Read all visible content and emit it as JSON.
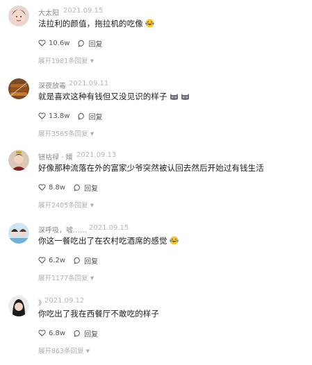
{
  "comments": [
    {
      "username": "大太阳",
      "date": "2021.09.15",
      "text": "法拉利的颜值，拖拉机的吃像",
      "emoji": "laughing-tears",
      "likes": "10.6w",
      "reply_label": "回复",
      "expand_label": "展开1981条回复"
    },
    {
      "username": "深夜放毒",
      "date": "2021.09.11",
      "text": "就是喜欢这种有钱但又没见识的样子",
      "emoji": "cat-faces",
      "likes": "13.8w",
      "reply_label": "回复",
      "expand_label": "展开3565条回复"
    },
    {
      "username": "钮祜禄 · 嬛",
      "date": "2021.09.13",
      "text": "好像那种流落在外的富家少爷突然被认回去然后开始过有钱生活",
      "likes": "8.8w",
      "reply_label": "回复",
      "expand_label": "展开2405条回复"
    },
    {
      "username": "深呼吸，嘘……",
      "date": "2021.09.15",
      "text": "你这一餐吃出了在农村吃酒席的感觉",
      "emoji": "laughing-tears",
      "likes": "6.2w",
      "reply_label": "回复",
      "expand_label": "展开1177条回复"
    },
    {
      "username": "》",
      "date": "2021.09.12",
      "text": "你吃出了我在西餐厅不敢吃的样子",
      "likes": "6.8w",
      "reply_label": "回复",
      "expand_label": "展开863条回复"
    }
  ]
}
